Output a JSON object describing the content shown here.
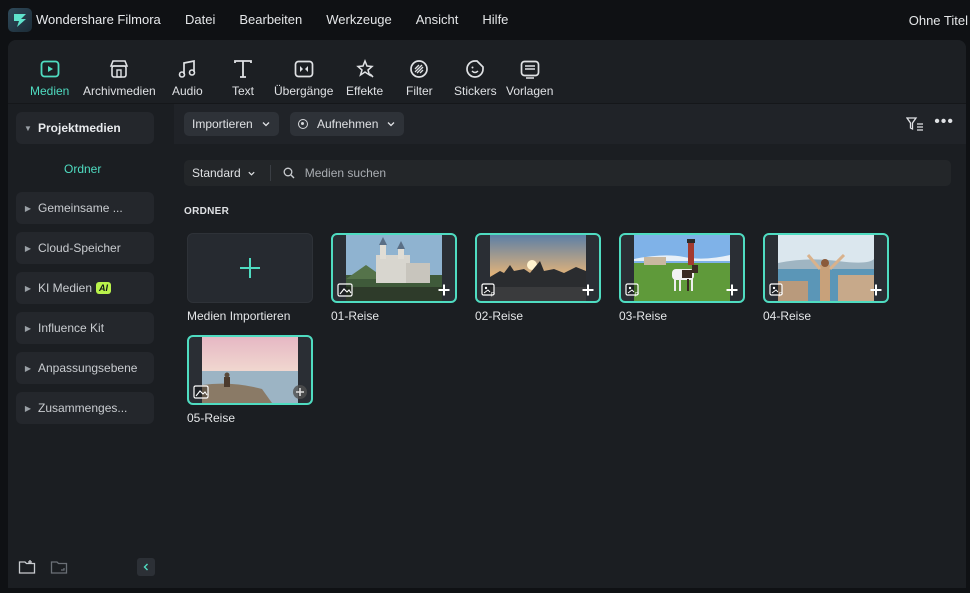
{
  "app": {
    "title": "Wondershare Filmora",
    "document_title": "Ohne Titel",
    "menu": [
      "Datei",
      "Bearbeiten",
      "Werkzeuge",
      "Ansicht",
      "Hilfe"
    ]
  },
  "toolbar": {
    "items": [
      {
        "label": "Medien",
        "icon": "media-icon",
        "active": true
      },
      {
        "label": "Archivmedien",
        "icon": "store-icon",
        "active": false
      },
      {
        "label": "Audio",
        "icon": "music-note-icon",
        "active": false
      },
      {
        "label": "Text",
        "icon": "text-icon",
        "active": false
      },
      {
        "label": "Übergänge",
        "icon": "transition-icon",
        "active": false
      },
      {
        "label": "Effekte",
        "icon": "effects-icon",
        "active": false
      },
      {
        "label": "Filter",
        "icon": "filter-icon",
        "active": false
      },
      {
        "label": "Stickers",
        "icon": "sticker-icon",
        "active": false
      },
      {
        "label": "Vorlagen",
        "icon": "template-icon",
        "active": false
      }
    ]
  },
  "sidebar": {
    "items": [
      {
        "label": "Projektmedien",
        "expanded": true
      },
      {
        "label": "Gemeinsame ...",
        "expanded": false
      },
      {
        "label": "Cloud-Speicher",
        "expanded": false
      },
      {
        "label": "KI Medien",
        "badge": "AI",
        "expanded": false
      },
      {
        "label": "Influence Kit",
        "expanded": false
      },
      {
        "label": "Anpassungsebene",
        "expanded": false
      },
      {
        "label": "Zusammenges...",
        "expanded": false
      }
    ],
    "subfolder": "Ordner"
  },
  "content": {
    "import_button": "Importieren",
    "record_button": "Aufnehmen",
    "sort_select": "Standard",
    "search_placeholder": "Medien suchen",
    "section_title": "ORDNER",
    "import_tile_label": "Medien Importieren",
    "media": [
      {
        "name": "01-Reise",
        "scene": "castle"
      },
      {
        "name": "02-Reise",
        "scene": "city-sunset"
      },
      {
        "name": "03-Reise",
        "scene": "horse-lighthouse"
      },
      {
        "name": "04-Reise",
        "scene": "woman-coast"
      },
      {
        "name": "05-Reise",
        "scene": "bird-sea"
      }
    ]
  },
  "colors": {
    "accent": "#4fdcc1",
    "background": "#1b1e22",
    "titlebar": "#0f1114"
  }
}
